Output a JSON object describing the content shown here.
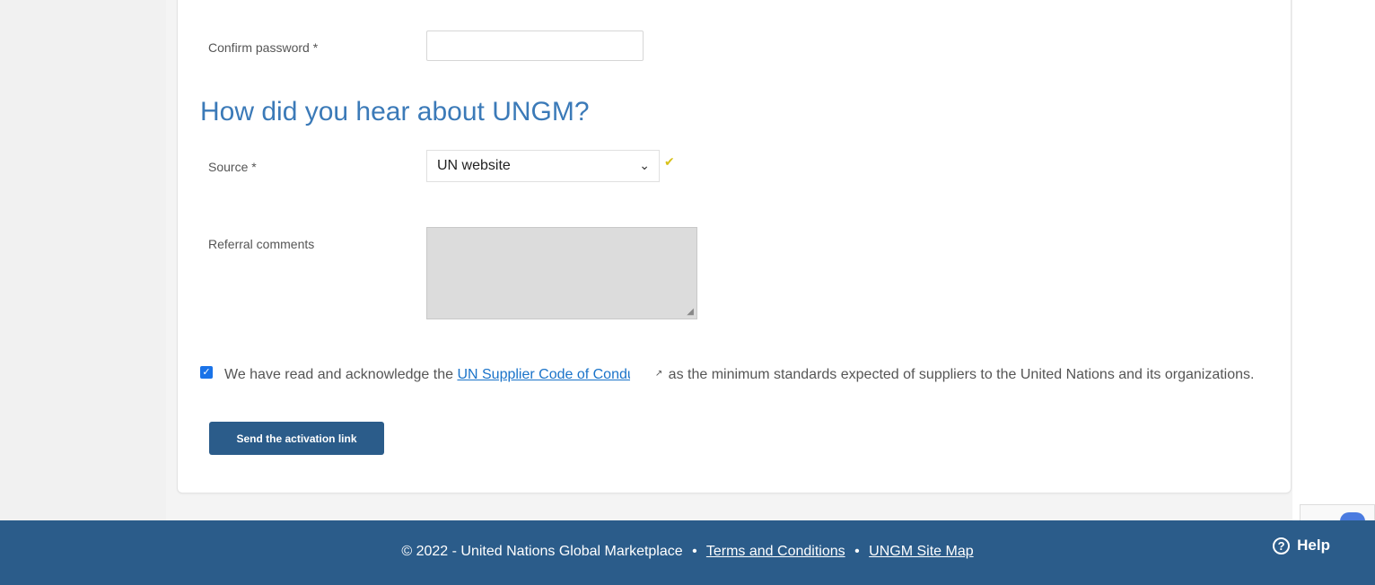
{
  "form": {
    "confirm_password_label": "Confirm password *",
    "confirm_password_value": "",
    "section_title": "How did you hear about UNGM?",
    "source_label": "Source *",
    "source_selected": "UN website",
    "referral_label": "Referral comments",
    "referral_value": "",
    "ack_checked": true,
    "ack_text_before": "We have read and acknowledge the ",
    "ack_link": "UN Supplier Code of Conduct",
    "ack_text_after": " as the minimum standards expected of suppliers to the United Nations and its organizations.",
    "submit_label": "Send the activation link"
  },
  "footer": {
    "copyright": "© 2022 - United Nations Global Marketplace",
    "separator": "•",
    "terms": "Terms and Conditions",
    "sitemap": "UNGM Site Map",
    "help": "Help"
  },
  "colors": {
    "accent": "#2b5c8a",
    "title": "#3b7ab8",
    "link": "#1a73c9"
  }
}
